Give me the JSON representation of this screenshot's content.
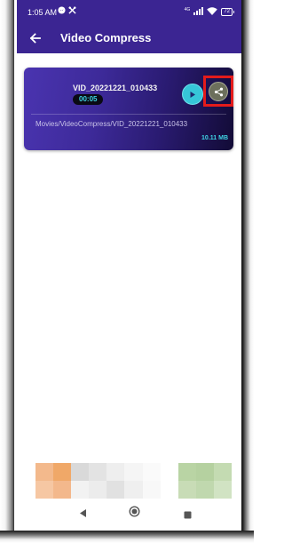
{
  "status_bar": {
    "time": "1:05 AM",
    "network": "4G",
    "battery": "72"
  },
  "app_bar": {
    "title": "Video Compress"
  },
  "video_item": {
    "filename": "VID_20221221_010433",
    "duration": "00:05",
    "path": "Movies/VideoCompress/VID_20221221_010433",
    "size": "10.11 MB"
  },
  "colors": {
    "primary": "#3b2592",
    "accent": "#36c6d8",
    "highlight": "#e41b1b"
  },
  "icons": {
    "back": "arrow-left-icon",
    "play": "play-icon",
    "share": "share-icon"
  }
}
